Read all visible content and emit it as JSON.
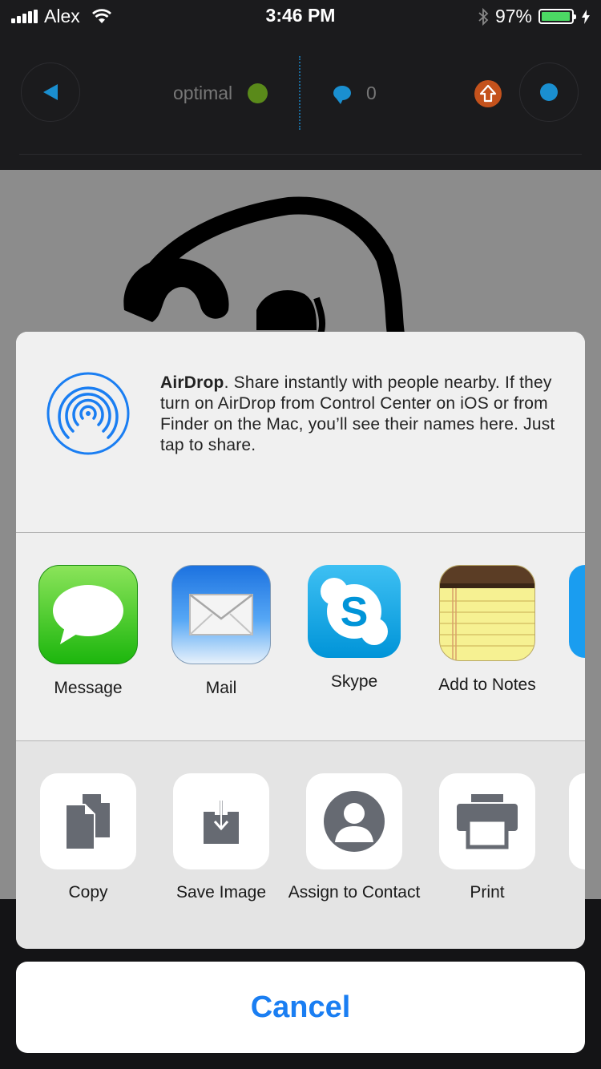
{
  "status_bar": {
    "carrier": "Alex",
    "time": "3:46 PM",
    "battery_percent": "97%",
    "battery_level": 0.97,
    "icons": [
      "signal-icon",
      "wifi-icon",
      "bluetooth-icon",
      "battery-icon",
      "charging-icon"
    ]
  },
  "app_header": {
    "status_label": "optimal",
    "comment_count": "0",
    "colors": {
      "accent": "#1a8fd0",
      "status_dot": "#5a8a1a",
      "upload": "#c4521c"
    }
  },
  "share_sheet": {
    "airdrop": {
      "title": "AirDrop",
      "description": ". Share instantly with people nearby. If they turn on AirDrop from Control Center on iOS or from Finder on the Mac, you’ll see their names here. Just tap to share.",
      "icon": "airdrop-icon"
    },
    "apps": [
      {
        "label": "Message",
        "icon": "messages-app-icon"
      },
      {
        "label": "Mail",
        "icon": "mail-app-icon"
      },
      {
        "label": "Skype",
        "icon": "skype-app-icon"
      },
      {
        "label": "Add to Notes",
        "icon": "notes-app-icon"
      }
    ],
    "actions": [
      {
        "label": "Copy",
        "icon": "copy-icon"
      },
      {
        "label": "Save Image",
        "icon": "save-image-icon"
      },
      {
        "label": "Assign to Contact",
        "icon": "contact-icon"
      },
      {
        "label": "Print",
        "icon": "print-icon"
      }
    ]
  },
  "cancel_label": "Cancel"
}
